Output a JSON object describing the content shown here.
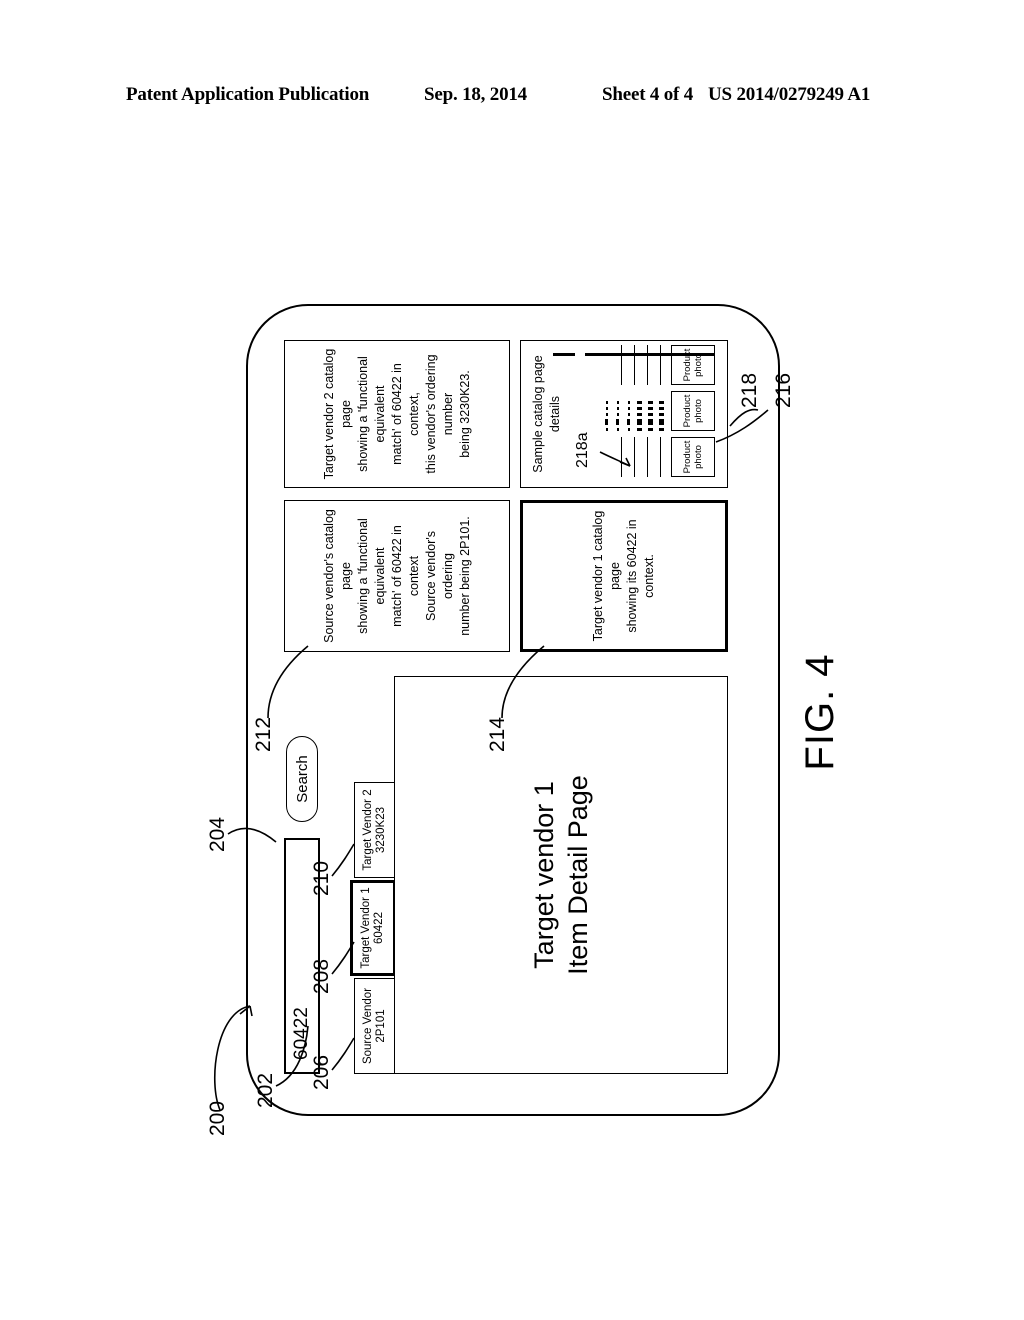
{
  "page_header": {
    "title": "Patent Application Publication",
    "date": "Sep. 18, 2014",
    "sheet": "Sheet 4 of 4",
    "publication_number": "US 2014/0279249 A1"
  },
  "figure": {
    "caption": "FIG. 4",
    "device_ref": "200"
  },
  "search": {
    "ref": "202",
    "value": "60422",
    "placeholder": "",
    "button_label": "Search"
  },
  "tabs": {
    "items": [
      {
        "ref": "206",
        "line1": "Source Vendor",
        "line2": "2P101",
        "selected": false
      },
      {
        "ref": "208",
        "line1": "Target Vendor 1",
        "line2": "60422",
        "selected": true
      },
      {
        "ref": "210",
        "line1": "Target Vendor 2",
        "line2": "3230K23",
        "selected": false
      }
    ]
  },
  "detail_panel": {
    "ref": "204",
    "line1": "Target vendor 1",
    "line2": "Item Detail Page"
  },
  "panels": [
    {
      "ref": "212",
      "name": "source-vendor-catalog",
      "lines": [
        "Source vendor's catalog page",
        "showing a 'functional equivalent",
        "match' of 60422 in context",
        "Source vendor's ordering",
        "number being 2P101."
      ],
      "emphasised": false
    },
    {
      "ref": "214",
      "name": "target-vendor-1-catalog",
      "lines": [
        "Target vendor 1 catalog page",
        "showing its 60422 in context."
      ],
      "emphasised": true
    },
    {
      "ref": "216",
      "name": "target-vendor-2-catalog",
      "lines": [
        "Target vendor 2 catalog page",
        "showing a 'functional equivalent",
        "match' of 60422 in context,",
        "this vendor's ordering number",
        "being 3230K23."
      ],
      "emphasised": false
    }
  ],
  "sample_details": {
    "ref": "218",
    "title": "Sample catalog page details",
    "highlight_ref": "218a",
    "photo_label_line1": "Product",
    "photo_label_line2": "photo",
    "columns": [
      {
        "style": "continuous",
        "rule_count": 4
      },
      {
        "style": "segmented",
        "row_count": 6,
        "bold_rows": [
          3,
          4,
          5
        ]
      },
      {
        "style": "continuous",
        "rule_count": 4
      }
    ]
  }
}
